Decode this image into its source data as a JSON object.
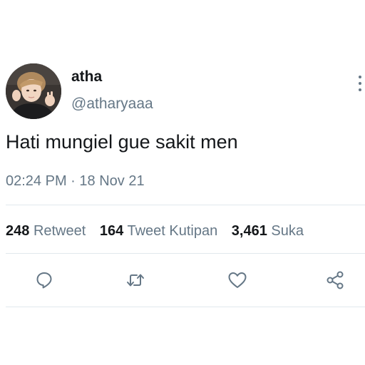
{
  "user": {
    "display_name": "atha",
    "handle": "@atharyaaa"
  },
  "tweet": {
    "text": "Hati mungiel gue sakit men",
    "time": "02:24 PM",
    "separator": "·",
    "date": "18 Nov 21"
  },
  "stats": {
    "retweets_count": "248",
    "retweets_label": "Retweet",
    "quotes_count": "164",
    "quotes_label": "Tweet Kutipan",
    "likes_count": "3,461",
    "likes_label": "Suka"
  },
  "actions": {
    "reply_icon": "speech-bubble-icon",
    "retweet_icon": "retweet-icon",
    "like_icon": "heart-icon",
    "share_icon": "share-icon"
  },
  "colors": {
    "text": "#14171a",
    "secondary": "#657786",
    "divider": "#e1e8ed"
  }
}
